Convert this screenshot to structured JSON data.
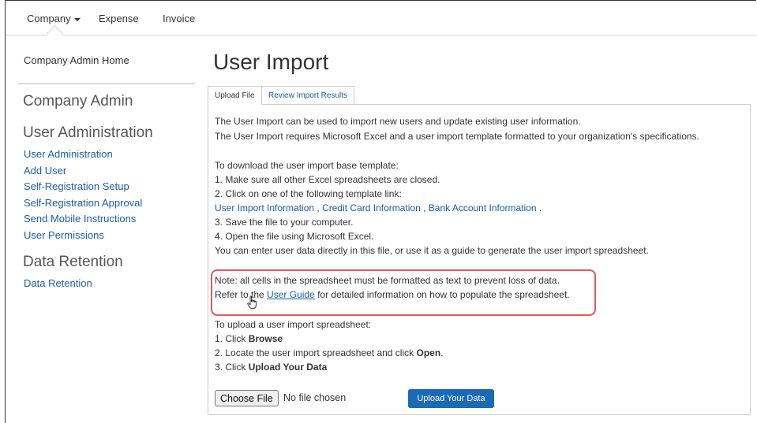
{
  "topnav": {
    "company_label": "Company",
    "expense_label": "Expense",
    "invoice_label": "Invoice"
  },
  "sidebar": {
    "home_link": "Company Admin Home",
    "section_company": "Company Admin",
    "section_user_admin": "User Administration",
    "user_admin_links": [
      "User Administration",
      "Add User",
      "Self-Registration Setup",
      "Self-Registration Approval",
      "Send Mobile Instructions",
      "User Permissions"
    ],
    "section_data_retention": "Data Retention",
    "data_retention_links": [
      "Data Retention"
    ]
  },
  "main": {
    "title": "User Import",
    "tabs": [
      {
        "label": "Upload File",
        "active": true
      },
      {
        "label": "Review Import Results",
        "active": false
      }
    ],
    "intro": [
      "The User Import can be used to import new users and update existing user information.",
      "The User Import requires Microsoft Excel and a user import template formatted to your organization's specifications."
    ],
    "download": {
      "heading": "To download the user import base template:",
      "step1": "1. Make sure all other Excel spreadsheets are closed.",
      "step2": "2. Click on one of the following template link:",
      "template_links": [
        "User Import Information",
        "Credit Card Information",
        "Bank Account Information"
      ],
      "sep": " , ",
      "end": " .",
      "step3": "3. Save the file to your computer.",
      "step4": "4. Open the file using Microsoft Excel.",
      "tip": "You can enter user data directly in this file, or use it as a guide to generate the user import spreadsheet."
    },
    "note": {
      "line1": "Note: all cells in the spreadsheet must be formatted as text to prevent loss of data.",
      "refer_prefix": "Refer to the ",
      "guide_link": "User Guide",
      "refer_suffix": " for detailed information on how to populate the spreadsheet."
    },
    "upload": {
      "heading": "To upload a user import spreadsheet:",
      "s1_prefix": "1. Click ",
      "s1_bold": "Browse",
      "s2_prefix": "2. Locate the user import spreadsheet and click ",
      "s2_bold": "Open",
      "s2_suffix": ".",
      "s3_prefix": "3. Click ",
      "s3_bold": "Upload Your Data"
    },
    "file_input": {
      "choose_label": "Choose File",
      "status": "No file chosen"
    },
    "upload_button": "Upload Your Data"
  },
  "colors": {
    "link": "#1a5fa0",
    "primary_button": "#1a6ab6",
    "highlight_box": "#e05a5f"
  }
}
